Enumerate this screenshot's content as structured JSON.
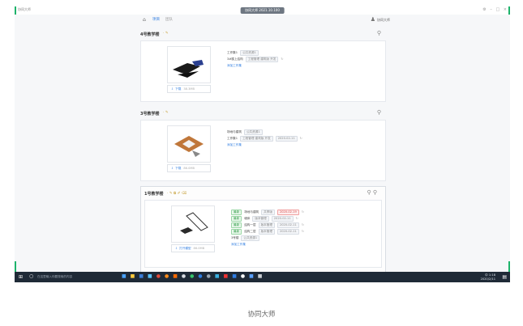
{
  "window": {
    "app_title": "协同大师",
    "center_badge": "协同大师 2021.10.100",
    "controls": [
      "⚙",
      "–",
      "□",
      "×"
    ]
  },
  "navbar": {
    "home_icon": "home-icon",
    "tabs": [
      {
        "label": "项目",
        "active": true
      },
      {
        "label": "团队",
        "active": false
      }
    ],
    "user_icon": "user-icon",
    "user_label": "协同大师"
  },
  "sections": [
    {
      "title": "4号教学楼",
      "icons": "· ✎",
      "actions": "⚲",
      "rows": [
        {
          "label": "工作集1",
          "tags": [
            "公共资源1"
          ]
        },
        {
          "label": "3#楼上结构",
          "tags": [
            "工程管理 建筑版 开发"
          ],
          "extra": "↻"
        }
      ],
      "add_link": "添加工作集",
      "download_label": "下载",
      "download_size": "38.3MB",
      "model_color": "#1a1a1a"
    },
    {
      "title": "3号教学楼",
      "icons": "· ✎",
      "actions": "⚲",
      "rows": [
        {
          "label": "场地与建筑",
          "tags": [
            "公共资源1"
          ]
        },
        {
          "label": "工作集1",
          "tags": [
            "工程管理 建筑版 开发",
            "2020-02-11"
          ],
          "extra": "↻"
        }
      ],
      "add_link": "添加工作集",
      "download_label": "下载",
      "download_size": "86.0MB",
      "model_color": "#c0773a"
    },
    {
      "title": "1号教学楼",
      "icons": "· ✎ ⧉ ✐ ⌫",
      "actions": "⚲ ⚲",
      "rows": [
        {
          "badge": "最新",
          "label": "场地与建筑",
          "tags": [
            "共享版",
            "2020-02-19"
          ],
          "red_tag": 1,
          "extra": "↻"
        },
        {
          "badge": "最新",
          "label": "墙体",
          "tags": [
            "版本管理",
            "2020-02-11"
          ],
          "extra": "↻"
        },
        {
          "badge": "最新",
          "label": "结构一层",
          "tags": [
            "版本管理",
            "2020-02-11"
          ],
          "extra": "↻"
        },
        {
          "badge": "最新",
          "label": "结构二层",
          "tags": [
            "版本管理",
            "2020-02-11"
          ],
          "extra": "↻"
        },
        {
          "label": "3号楼",
          "tags": [
            "公共资源1"
          ]
        }
      ],
      "add_link": "添加工作集",
      "download_label": "打开模型",
      "download_size": "86.0MB",
      "model_color": "#2a2a2a"
    }
  ],
  "taskbar": {
    "search_placeholder": "在这里输入你要搜索的内容",
    "tray_time": "1:18",
    "tray_date": "2020/2/11",
    "tray_lang": "中"
  },
  "caption": "协同大师",
  "colors": {
    "accent": "#2f7de1",
    "green": "#1db36b",
    "taskbar": "#1f2a37"
  }
}
